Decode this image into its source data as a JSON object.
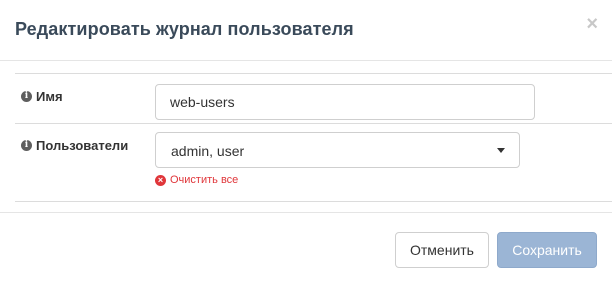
{
  "dialog": {
    "title": "Редактировать журнал пользователя",
    "close_label": "×"
  },
  "form": {
    "name": {
      "label": "Имя",
      "value": "web-users"
    },
    "users": {
      "label": "Пользователи",
      "selected": "admin, user",
      "clear_all_label": "Очистить все"
    }
  },
  "footer": {
    "cancel_label": "Отменить",
    "save_label": "Сохранить"
  },
  "colors": {
    "accent_disabled": "#9bb5d5",
    "danger": "#e0363a",
    "title": "#3a4a5a"
  }
}
